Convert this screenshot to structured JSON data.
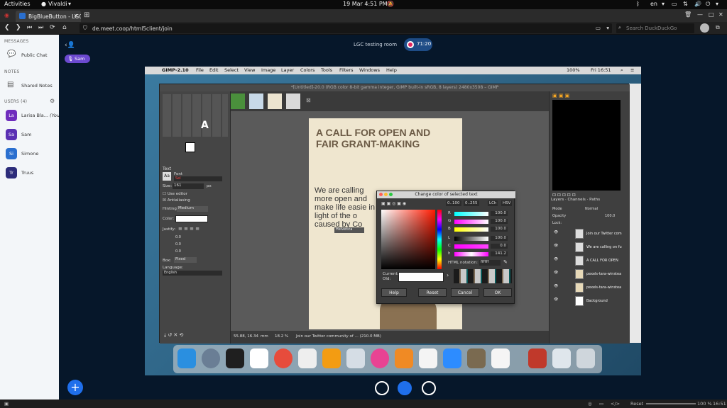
{
  "topbar": {
    "activities": "Activities",
    "app": "Vivaldi",
    "datetime": "19 Mar  4:51 PM",
    "lang": "en"
  },
  "tab": {
    "title": "BigBlueButton - LGC testin"
  },
  "address": {
    "url": "de.meet.coop/html5client/join",
    "search_placeholder": "Search DuckDuckGo"
  },
  "leftpanel": {
    "messages": "MESSAGES",
    "public_chat": "Public Chat",
    "notes": "NOTES",
    "shared_notes": "Shared Notes",
    "users_header": "USERS (4)",
    "users": [
      {
        "initials": "La",
        "name": "Larisa Bla...",
        "tag": "(You)",
        "color": "#6f2dbd"
      },
      {
        "initials": "Sa",
        "name": "Sam",
        "tag": "",
        "color": "#5a30b4"
      },
      {
        "initials": "Si",
        "name": "Simone",
        "tag": "",
        "color": "#2a6fcf"
      },
      {
        "initials": "Tr",
        "name": "Truus",
        "tag": "",
        "color": "#2c2c7a"
      }
    ]
  },
  "meeting": {
    "room": "LGC testing room",
    "timer": "71:20",
    "talker": "Sam"
  },
  "share": {
    "mac_app": "GIMP-2.10",
    "mac_menus": [
      "File",
      "Edit",
      "Select",
      "View",
      "Image",
      "Layer",
      "Colors",
      "Tools",
      "Filters",
      "Windows",
      "Help"
    ],
    "mac_battery": "100%",
    "mac_clock": "Fri 16:51",
    "gimp_title": "*[Untitled]-20.0 (RGB color 8-bit gamma integer, GIMP built-in sRGB, 8 layers) 2480x3508 – GIMP",
    "headline": "A CALL FOR OPEN AND FAIR GRANT-MAKING",
    "body": "We are calling more open and make life easie in light of the o caused by Co",
    "text_tool": {
      "header": "Text",
      "font": "Font",
      "font_value": "Sel",
      "size_label": "Size:",
      "size_value": "161",
      "size_unit": "px",
      "use_editor": "Use editor",
      "antialiasing": "Antialiasing",
      "hinting_label": "Hinting:",
      "hinting_value": "Medium",
      "color_label": "Color:",
      "justify_label": "Justify:",
      "box_label": "Box:",
      "box_value": "Fixed",
      "language_label": "Language:",
      "language_value": "English",
      "spin": [
        "0.0",
        "0.0",
        "0.0"
      ]
    },
    "statusline": {
      "coords": "55.88, 16.34",
      "unit": "mm",
      "zoom": "18.2 %",
      "message": "Join our Twitter community of ... (210.0 MB)"
    },
    "dock_tabs": [
      "Layers",
      "Channels",
      "Paths"
    ],
    "layer_mode": "Mode",
    "layer_mode_value": "Normal",
    "opacity_label": "Opacity",
    "opacity_value": "100.0",
    "lock_label": "Lock:",
    "layers": [
      "Join our Twitter com",
      "We are calling on fu",
      "A CALL FOR OPEN",
      "pexels-tara-winstea",
      "pexels-tara-winstea",
      "Background"
    ],
    "dialog": {
      "title": "Change color of selected text",
      "scale_a": "0..100",
      "scale_b": "0..255",
      "model_a": "LCh",
      "model_b": "HSV",
      "channels": [
        {
          "label": "R",
          "value": "100.0"
        },
        {
          "label": "G",
          "value": "100.0"
        },
        {
          "label": "B",
          "value": "100.0"
        },
        {
          "label": "L",
          "value": "100.0"
        },
        {
          "label": "C",
          "value": "0.0"
        },
        {
          "label": "h",
          "value": "141.2"
        }
      ],
      "html_label": "HTML notation:",
      "html_value": "ffffff",
      "current_label": "Current:",
      "old_label": "Old:",
      "buttons": [
        "Help",
        "Reset",
        "Cancel",
        "OK"
      ]
    },
    "font_popup": "Helvetica"
  },
  "statusbar": {
    "reset": "Reset",
    "zoom": "100 %",
    "clock": "16:51"
  }
}
